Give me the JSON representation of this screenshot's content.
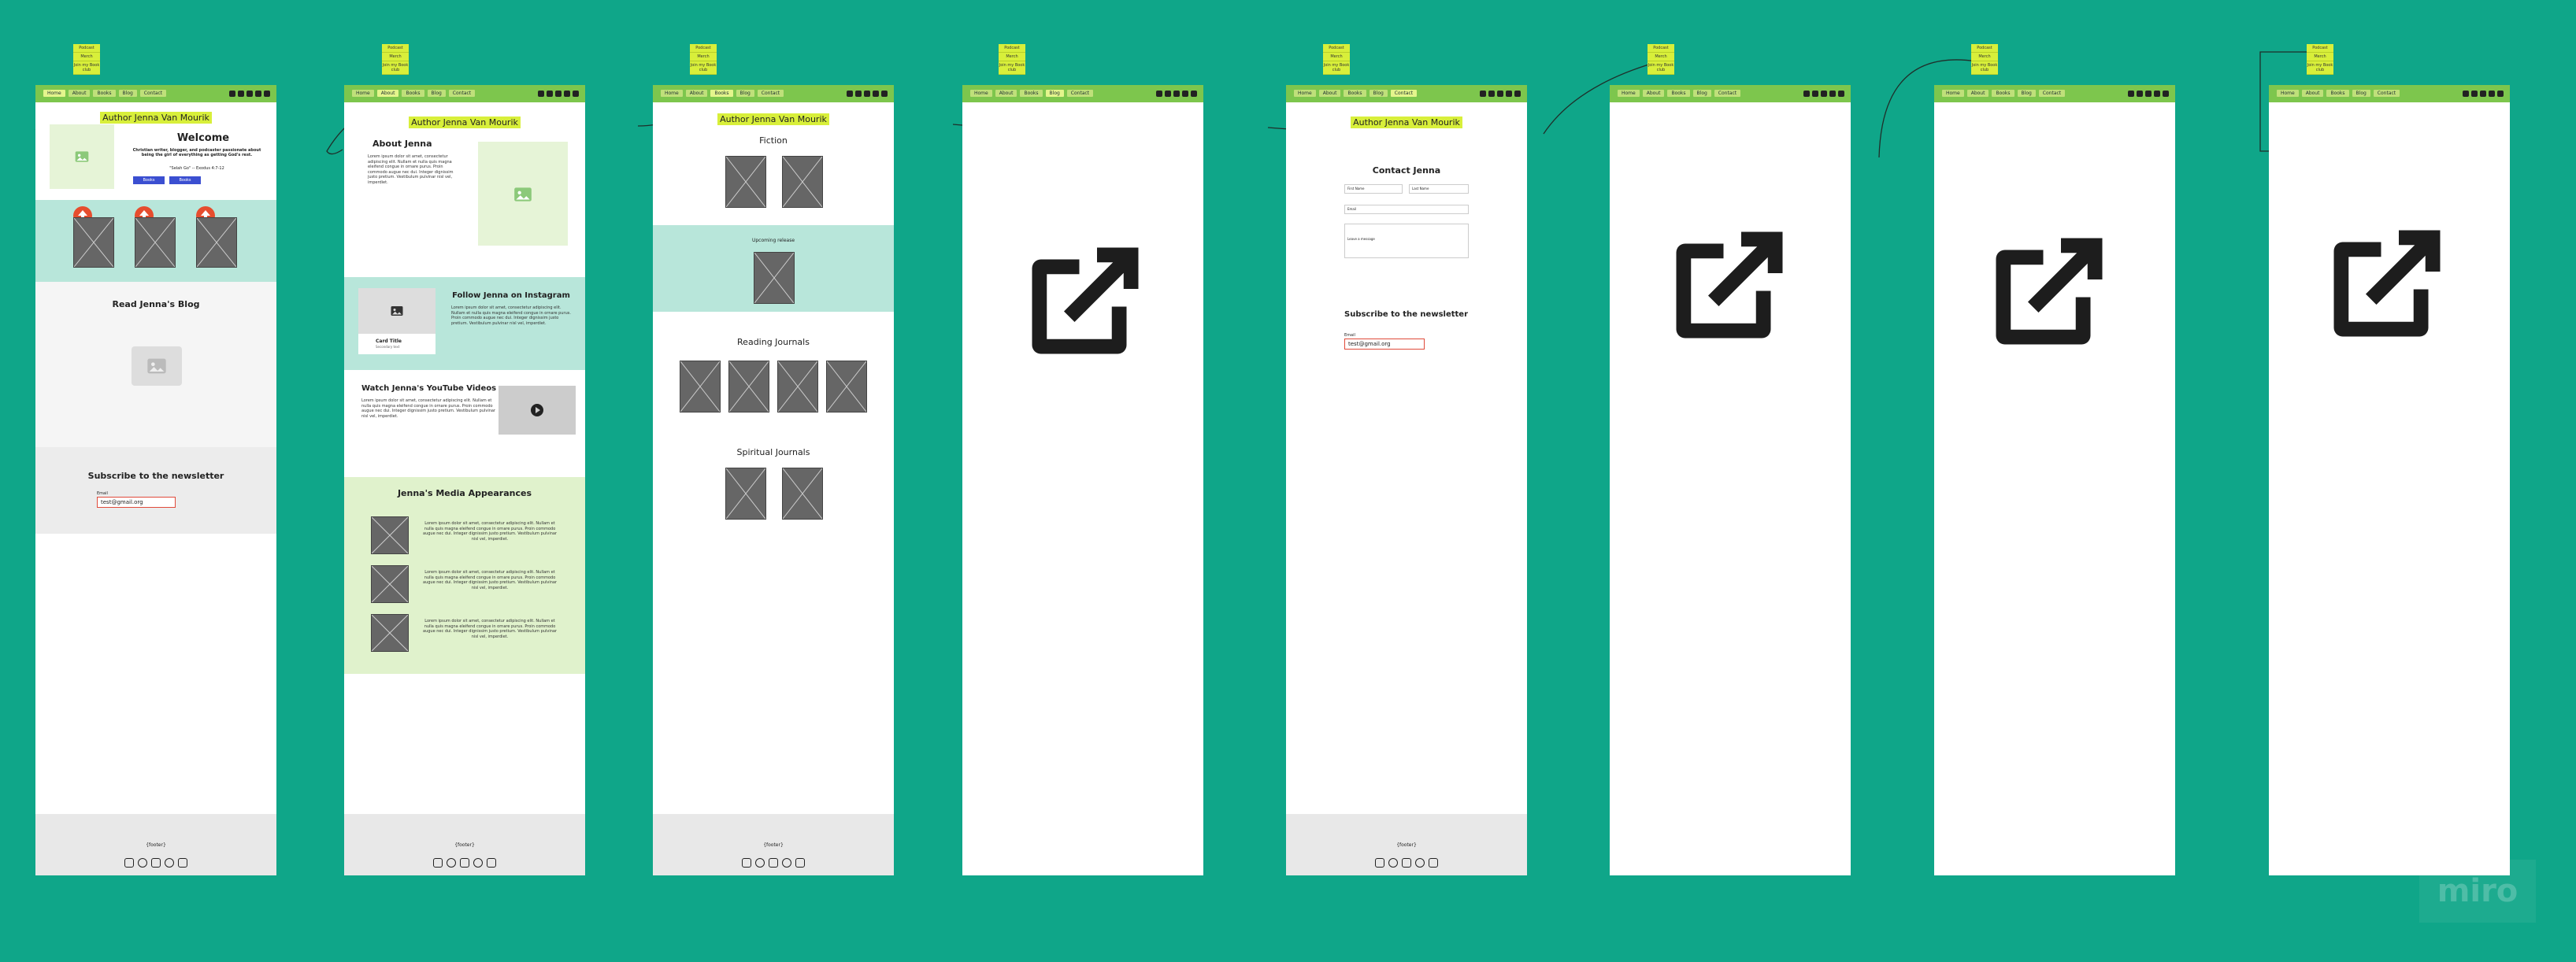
{
  "nav": [
    "Home",
    "About",
    "Books",
    "Blog",
    "Contact"
  ],
  "sticky_notes": [
    "Podcast",
    "Merch",
    "Join my Book club"
  ],
  "author": "Author Jenna Van Mourik",
  "home": {
    "welcome": "Welcome",
    "tagline": "Christian writer, blogger, and podcaster passionate about being the girl of everything as getting God's rest.",
    "verse": "\"Selah Go\" -- Exodus 4:7-12",
    "btn1": "Books",
    "btn2": "Books",
    "blog_title": "Read Jenna's Blog",
    "newsletter": "Subscribe to the newsletter",
    "email_label": "Email",
    "email_value": "test@gmail.org"
  },
  "about": {
    "title": "About Jenna",
    "instagram_title": "Follow Jenna on Instagram",
    "card_title": "Card Title",
    "card_sub": "Secondary text",
    "youtube_title": "Watch Jenna's YouTube Videos",
    "media_title": "Jenna's Media Appearances"
  },
  "books": {
    "fiction": "Fiction",
    "upcoming": "Upcoming release",
    "reading": "Reading Journals",
    "spiritual": "Spiritual Journals"
  },
  "contact": {
    "title": "Contact Jenna",
    "first": "First Name",
    "last": "Last Name",
    "email": "Email",
    "message": "Leave a message",
    "newsletter": "Subscribe to the newsletter",
    "email_label": "Email",
    "email_value": "test@gmail.org"
  },
  "footer": "{footer}",
  "lorem": "Lorem ipsum dolor sit amet, consectetur adipiscing elit. Nullam et nulla quis magna eleifend congue in ornare purus. Proin commodo augue nec dui. Integer dignissim justo pretium. Vestibulum pulvinar nisl vel, imperdiet.",
  "miro": "miro",
  "colors": {
    "board": "#0fa689",
    "nav": "#7dc64d",
    "sticky": "#d8ef3a",
    "teal": "#b8e6da",
    "green": "#e0f2cc"
  }
}
